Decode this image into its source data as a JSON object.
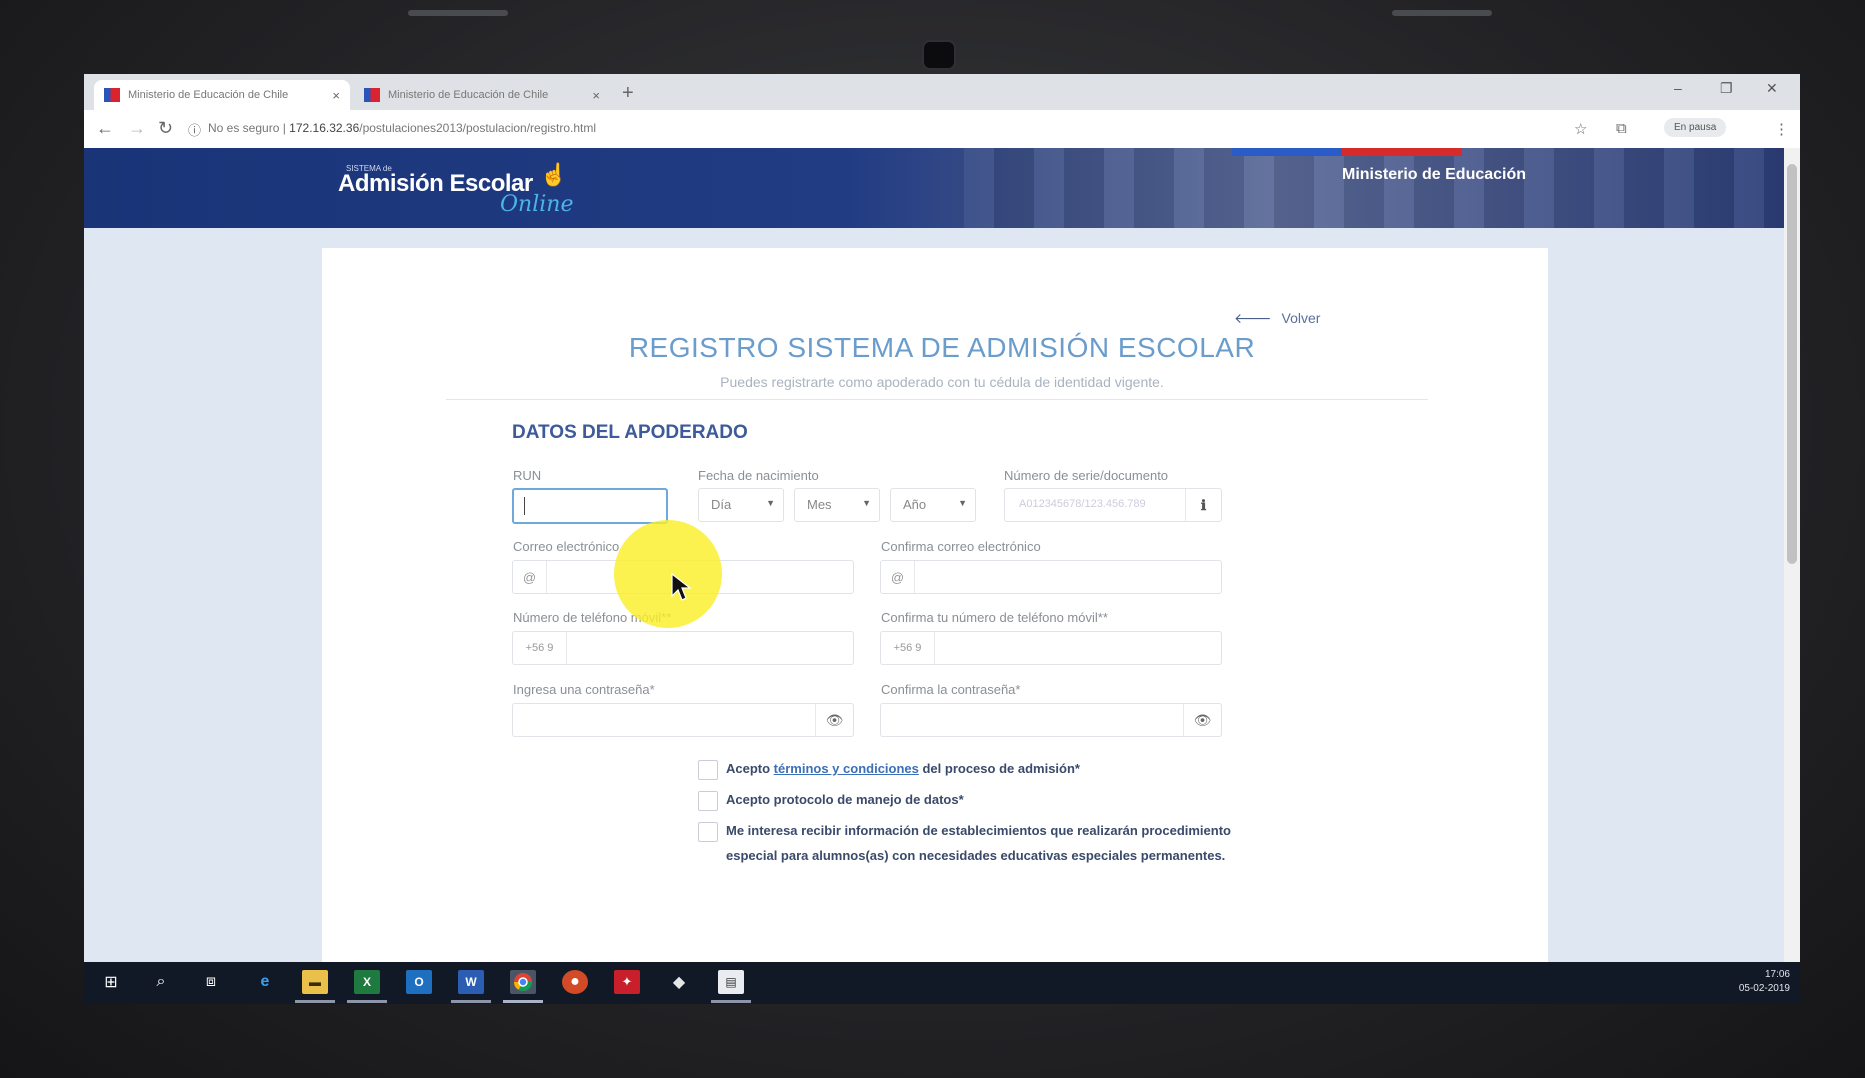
{
  "browser": {
    "tabs": [
      {
        "title": "Ministerio de Educación de Chile",
        "close": "×"
      },
      {
        "title": "Ministerio de Educación de Chile",
        "close": "×"
      }
    ],
    "new_tab": "+",
    "window_controls": {
      "minimize": "–",
      "maximize": "❐",
      "close": "✕"
    },
    "address": {
      "security": "No es seguro",
      "host": "172.16.32.36",
      "path": "/postulaciones2013/postulacion/registro.html"
    },
    "paused_label": "En pausa"
  },
  "header": {
    "logo_small": "SISTEMA de",
    "logo": "Admisión Escolar",
    "logo_online": "Online",
    "ministry": "Ministerio de Educación"
  },
  "page": {
    "back_label": "Volver",
    "title": "REGISTRO SISTEMA DE ADMISIÓN ESCOLAR",
    "subtitle": "Puedes registrarte como apoderado con tu cédula de identidad vigente.",
    "section_title": "DATOS DEL APODERADO"
  },
  "form": {
    "run_label": "RUN",
    "birth_label": "Fecha de nacimiento",
    "day_option": "Día",
    "month_option": "Mes",
    "year_option": "Año",
    "serial_label": "Número de serie/documento",
    "serial_placeholder": "A012345678/123.456.789",
    "email_label": "Correo electrónico",
    "email_confirm_label": "Confirma correo electrónico",
    "email_addon": "@",
    "phone_label": "Número de teléfono móvil**",
    "phone_confirm_label": "Confirma tu número de teléfono móvil**",
    "phone_prefix": "+56 9",
    "password_label": "Ingresa una contraseña*",
    "password_confirm_label": "Confirma la contraseña*"
  },
  "checkboxes": {
    "terms_prefix": "Acepto ",
    "terms_link": "términos y condiciones",
    "terms_suffix": " del proceso de admisión*",
    "protocol": "Acepto protocolo de manejo de datos*",
    "info": "Me interesa recibir información de establecimientos que realizarán procedimiento especial para alumnos(as) con necesidades educativas especiales permanentes."
  },
  "taskbar": {
    "time": "17:06",
    "date": "05-02-2019"
  },
  "colors": {
    "banner": "#1a3478",
    "title": "#6a9ccc",
    "section_title": "#3d5a9a",
    "highlight": "#faee28"
  }
}
